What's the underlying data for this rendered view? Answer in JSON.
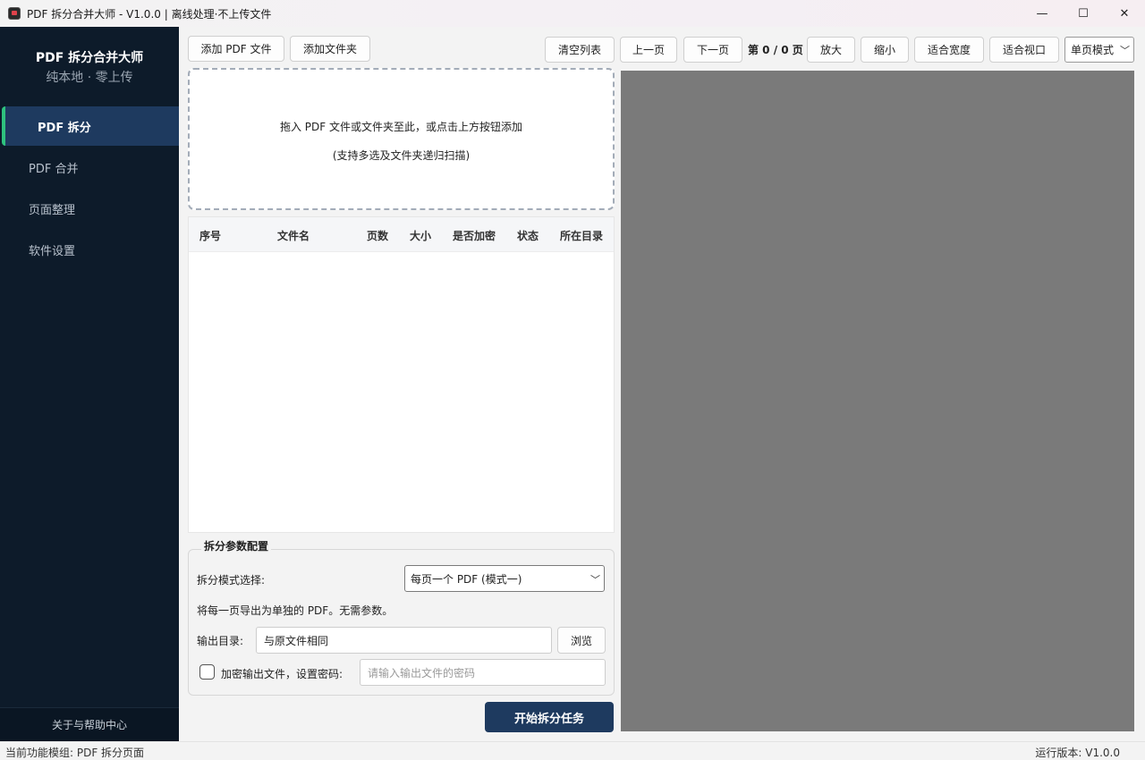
{
  "window": {
    "title": "PDF 拆分合并大师 - V1.0.0 | 离线处理·不上传文件",
    "minimize": "—",
    "maximize": "☐",
    "close": "✕"
  },
  "sidebar": {
    "brand_title": "PDF 拆分合并大师",
    "brand_sub": "纯本地 · 零上传",
    "items": [
      {
        "label": "PDF 拆分"
      },
      {
        "label": "PDF 合并"
      },
      {
        "label": "页面整理"
      },
      {
        "label": "软件设置"
      }
    ],
    "help": "关于与帮助中心"
  },
  "toolbar": {
    "add_pdf": "添加 PDF 文件",
    "add_folder": "添加文件夹",
    "clear_list": "清空列表",
    "prev_page": "上一页",
    "next_page": "下一页",
    "page_indicator": "第 0 / 0 页",
    "zoom_in": "放大",
    "zoom_out": "缩小",
    "fit_width": "适合宽度",
    "fit_view": "适合视口",
    "view_mode": "单页模式"
  },
  "dropzone": {
    "line1": "拖入 PDF 文件或文件夹至此，或点击上方按钮添加",
    "line2": "(支持多选及文件夹递归扫描)"
  },
  "table": {
    "columns": [
      "序号",
      "文件名",
      "页数",
      "大小",
      "是否加密",
      "状态",
      "所在目录"
    ],
    "rows": []
  },
  "split_config": {
    "title": "拆分参数配置",
    "mode_label": "拆分模式选择:",
    "mode_value": "每页一个 PDF (模式一)",
    "mode_desc": "将每一页导出为单独的 PDF。无需参数。",
    "output_label": "输出目录:",
    "output_value": "与原文件相同",
    "browse": "浏览",
    "encrypt_label": "加密输出文件，设置密码:",
    "encrypt_checked": false,
    "password_placeholder": "请输入输出文件的密码",
    "start": "开始拆分任务"
  },
  "status": {
    "left": "当前功能模组: PDF 拆分页面",
    "right": "运行版本: V1.0.0"
  },
  "colors": {
    "sidebar_bg": "#0d1b2a",
    "active_item_bg": "#1e3a5f",
    "active_accent": "#2ec27e",
    "primary_button": "#1e3a5f",
    "preview_bg": "#7a7a7a"
  }
}
